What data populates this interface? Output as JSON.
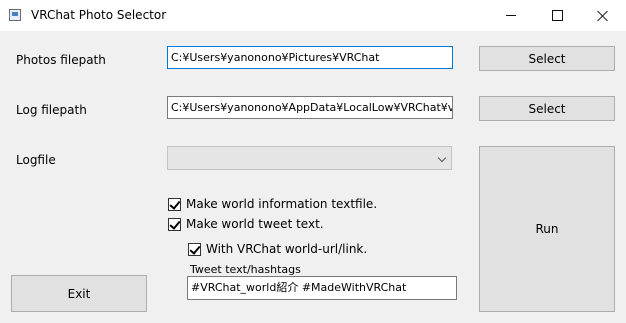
{
  "window": {
    "title": "VRChat Photo Selector"
  },
  "photos": {
    "label": "Photos filepath",
    "value": "C:¥Users¥yanonono¥Pictures¥VRChat",
    "button": "Select"
  },
  "log": {
    "label": "Log filepath",
    "value": "C:¥Users¥yanonono¥AppData¥LocalLow¥VRChat¥vrchat",
    "button": "Select"
  },
  "logfile": {
    "label": "Logfile",
    "selected": ""
  },
  "options": {
    "world_textfile": {
      "label": "Make world information textfile.",
      "checked": true
    },
    "world_tweet": {
      "label": "Make world tweet text.",
      "checked": true
    },
    "world_url": {
      "label": "With VRChat world-url/link.",
      "checked": true
    }
  },
  "tweet": {
    "label": "Tweet text/hashtags",
    "value": "#VRChat_world紹介 #MadeWithVRChat"
  },
  "buttons": {
    "run": "Run",
    "exit": "Exit"
  },
  "icons": {
    "app": "app-window-icon",
    "minimize": "minimize-icon",
    "maximize": "maximize-icon",
    "close": "close-icon",
    "dropdown": "chevron-down-icon",
    "check": "checkmark-icon"
  }
}
